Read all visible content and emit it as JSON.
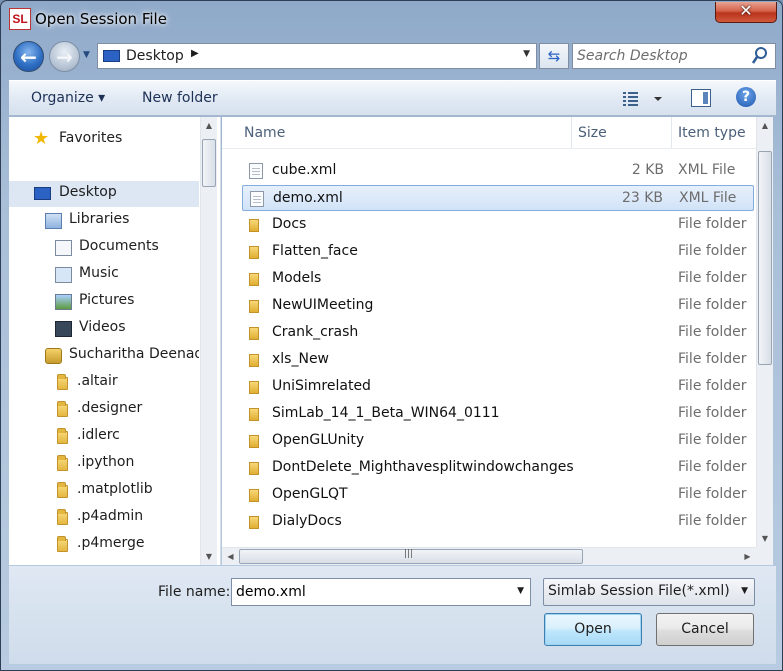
{
  "window": {
    "title": "Open Session File",
    "app_icon_text": "SL",
    "close_glyph": "✕"
  },
  "nav": {
    "address": "Desktop",
    "search_placeholder": "Search Desktop"
  },
  "toolbar": {
    "organize_label": "Organize ▾",
    "new_folder_label": "New folder",
    "help_glyph": "?"
  },
  "sidebar": {
    "items": [
      {
        "label": "Favorites",
        "icon": "star-icon"
      },
      {
        "label": "Desktop",
        "icon": "desktop-icon",
        "selected": true
      },
      {
        "label": "Libraries",
        "icon": "libraries-icon"
      },
      {
        "label": "Documents",
        "icon": "documents-icon"
      },
      {
        "label": "Music",
        "icon": "music-icon"
      },
      {
        "label": "Pictures",
        "icon": "pictures-icon"
      },
      {
        "label": "Videos",
        "icon": "videos-icon"
      },
      {
        "label": "Sucharitha Deenada",
        "icon": "user-folder-icon"
      },
      {
        "label": ".altair",
        "icon": "folder-icon"
      },
      {
        "label": ".designer",
        "icon": "folder-icon"
      },
      {
        "label": ".idlerc",
        "icon": "folder-icon"
      },
      {
        "label": ".ipython",
        "icon": "folder-icon"
      },
      {
        "label": ".matplotlib",
        "icon": "folder-icon"
      },
      {
        "label": ".p4admin",
        "icon": "folder-icon"
      },
      {
        "label": ".p4merge",
        "icon": "folder-icon"
      }
    ]
  },
  "file_list": {
    "columns": {
      "name": "Name",
      "size": "Size",
      "type": "Item type"
    },
    "rows": [
      {
        "name": "cube.xml",
        "size": "2 KB",
        "type": "XML File",
        "kind": "xml"
      },
      {
        "name": "demo.xml",
        "size": "23 KB",
        "type": "XML File",
        "kind": "xml",
        "selected": true
      },
      {
        "name": "Docs",
        "size": "",
        "type": "File folder",
        "kind": "folder"
      },
      {
        "name": "Flatten_face",
        "size": "",
        "type": "File folder",
        "kind": "folder"
      },
      {
        "name": "Models",
        "size": "",
        "type": "File folder",
        "kind": "folder"
      },
      {
        "name": "NewUIMeeting",
        "size": "",
        "type": "File folder",
        "kind": "folder"
      },
      {
        "name": "Crank_crash",
        "size": "",
        "type": "File folder",
        "kind": "folder"
      },
      {
        "name": "xls_New",
        "size": "",
        "type": "File folder",
        "kind": "folder"
      },
      {
        "name": "UniSimrelated",
        "size": "",
        "type": "File folder",
        "kind": "folder"
      },
      {
        "name": "SimLab_14_1_Beta_WIN64_0111",
        "size": "",
        "type": "File folder",
        "kind": "folder"
      },
      {
        "name": "OpenGLUnity",
        "size": "",
        "type": "File folder",
        "kind": "folder"
      },
      {
        "name": "DontDelete_Mighthavesplitwindowchanges",
        "size": "",
        "type": "File folder",
        "kind": "folder"
      },
      {
        "name": "OpenGLQT",
        "size": "",
        "type": "File folder",
        "kind": "folder"
      },
      {
        "name": "DialyDocs",
        "size": "",
        "type": "File folder",
        "kind": "folder"
      }
    ]
  },
  "footer": {
    "file_name_label": "File name:",
    "file_name_value": "demo.xml",
    "file_type_value": "Simlab Session File(*.xml)",
    "open_label": "Open",
    "cancel_label": "Cancel"
  },
  "colors": {
    "selection_bg": "#d1e3f8",
    "selection_border": "#84acdd",
    "accent": "#2b62c4"
  }
}
